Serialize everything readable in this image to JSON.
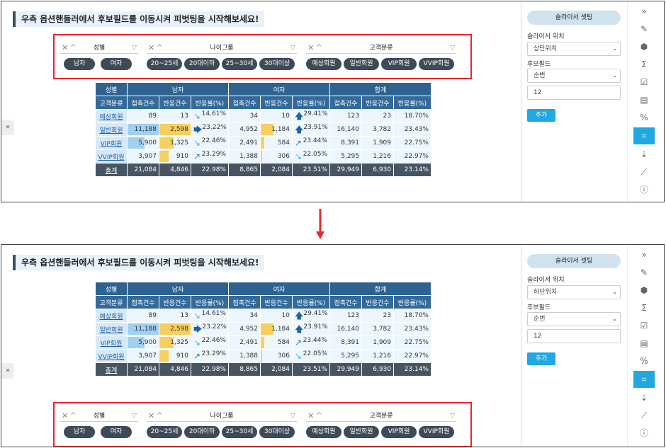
{
  "title": "우측 옵션핸들러에서 후보필드를 이동시켜 피벗팅을 시작해보세요!",
  "slicers": [
    {
      "name": "성별",
      "options": [
        "남자",
        "여자"
      ]
    },
    {
      "name": "나이그룹",
      "options": [
        "20~25세",
        "20대이하",
        "25~30세",
        "30대이상"
      ]
    },
    {
      "name": "고객분류",
      "options": [
        "예상회원",
        "일반회원",
        "VIP회원",
        "VVIP회원"
      ]
    }
  ],
  "table": {
    "group_header": {
      "corner": "성별",
      "male": "남자",
      "female": "여자",
      "total": "합계"
    },
    "sub_headers": {
      "corner": "고객분류",
      "cols": [
        "접촉건수",
        "반응건수",
        "반응률(%)"
      ]
    },
    "rows": [
      {
        "label": "예상회원",
        "m": [
          "89",
          "13",
          "14.61%"
        ],
        "f": [
          "34",
          "10",
          "29.41%"
        ],
        "t": [
          "123",
          "23",
          "18.70%"
        ]
      },
      {
        "label": "일반회원",
        "m": [
          "11,188",
          "2,598",
          "23.22%"
        ],
        "f": [
          "4,952",
          "1,184",
          "23.91%"
        ],
        "t": [
          "16,140",
          "3,782",
          "23.43%"
        ]
      },
      {
        "label": "VIP회원",
        "m": [
          "5,900",
          "1,325",
          "22.46%"
        ],
        "f": [
          "2,491",
          "584",
          "23.44%"
        ],
        "t": [
          "8,391",
          "1,909",
          "22.75%"
        ]
      },
      {
        "label": "VVIP회원",
        "m": [
          "3,907",
          "910",
          "23.29%"
        ],
        "f": [
          "1,388",
          "306",
          "22.05%"
        ],
        "t": [
          "5,295",
          "1,216",
          "22.97%"
        ]
      },
      {
        "label": "총계",
        "m": [
          "21,084",
          "4,846",
          "22.98%"
        ],
        "f": [
          "8,865",
          "2,084",
          "23.51%"
        ],
        "t": [
          "29,949",
          "6,930",
          "23.14%"
        ]
      }
    ]
  },
  "sidebar": {
    "title": "슬라이서 셋팅",
    "position_label": "슬라이서 위치",
    "position_top": "상단위치",
    "position_bottom": "하단위치",
    "field_label": "후보필드",
    "field_value": "순번",
    "field_input": "12",
    "add_button": "추가"
  },
  "colors": {
    "header": "#2e6391",
    "total_row": "#475461",
    "accent": "#1fa8e1",
    "highlight_border": "#e8262b",
    "arrow": "#e8262b"
  },
  "rail_icons": [
    "double-chevron-right-icon",
    "edit-icon",
    "cube-icon",
    "sigma-icon",
    "checklist-icon",
    "layout-icon",
    "percent-icon",
    "crop-icon",
    "sort-icon",
    "chart-icon",
    "info-icon"
  ]
}
